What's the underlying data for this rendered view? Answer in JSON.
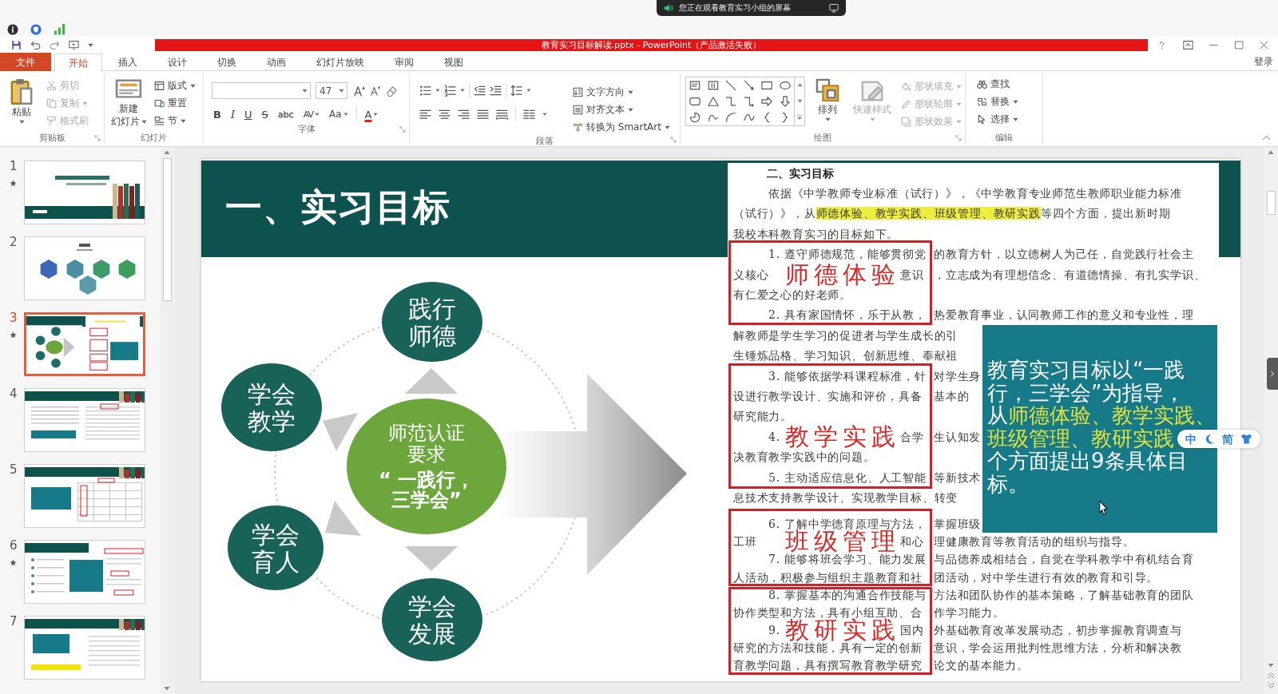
{
  "share_banner": {
    "text": "您正在观看教育实习小组的屏幕"
  },
  "title_bar": {
    "title": "教育实习目标解读.pptx - PowerPoint（产品激活失败）"
  },
  "ribbon": {
    "tabs": [
      {
        "label": "文件",
        "kind": "backstage",
        "selected": false
      },
      {
        "label": "开始",
        "kind": "tab",
        "selected": true
      },
      {
        "label": "插入",
        "kind": "tab",
        "selected": false
      },
      {
        "label": "设计",
        "kind": "tab",
        "selected": false
      },
      {
        "label": "切换",
        "kind": "tab",
        "selected": false
      },
      {
        "label": "动画",
        "kind": "tab",
        "selected": false
      },
      {
        "label": "幻灯片放映",
        "kind": "tab",
        "selected": false
      },
      {
        "label": "审阅",
        "kind": "tab",
        "selected": false
      },
      {
        "label": "视图",
        "kind": "tab",
        "selected": false
      }
    ],
    "account": "登录",
    "groups": [
      {
        "kind": "clipboard",
        "label": "剪贴板",
        "paste": "粘贴",
        "items": [
          {
            "label": "剪切",
            "kind": "cut",
            "disabled": true
          },
          {
            "label": "复制",
            "kind": "copy",
            "disabled": true
          },
          {
            "label": "格式刷",
            "kind": "painter",
            "disabled": true
          }
        ]
      },
      {
        "kind": "slides",
        "label": "幻灯片",
        "new_slide": [
          "新建",
          "幻灯片"
        ],
        "items": [
          {
            "label": "版式",
            "kind": "layout"
          },
          {
            "label": "重置",
            "kind": "reset"
          },
          {
            "label": "节",
            "kind": "section"
          }
        ]
      },
      {
        "kind": "font",
        "label": "字体",
        "font_size": "47",
        "buttons": [
          {
            "label": "B",
            "kind": "bold"
          },
          {
            "label": "I",
            "kind": "italic"
          },
          {
            "label": "U",
            "kind": "underline"
          },
          {
            "label": "S",
            "kind": "strike"
          },
          {
            "label": "abc",
            "kind": "shadow"
          },
          {
            "label": "AV",
            "kind": "spacing"
          },
          {
            "label": "Aa",
            "kind": "case"
          },
          {
            "label": "A",
            "kind": "color"
          }
        ]
      },
      {
        "kind": "paragraph",
        "label": "段落",
        "items": [
          {
            "label": "文字方向",
            "kind": "direction"
          },
          {
            "label": "对齐文本",
            "kind": "align"
          },
          {
            "label": "转换为 SmartArt",
            "kind": "smartart"
          }
        ]
      },
      {
        "kind": "drawing",
        "label": "绘图",
        "arrange": "排列",
        "quick_styles": {
          "label": "快速样式",
          "disabled": true
        },
        "items": [
          {
            "label": "形状填充",
            "kind": "fill",
            "disabled": true
          },
          {
            "label": "形状轮廓",
            "kind": "outline",
            "disabled": true
          },
          {
            "label": "形状效果",
            "kind": "effects",
            "disabled": true
          }
        ]
      },
      {
        "kind": "editing",
        "label": "编辑",
        "items": [
          {
            "label": "查找",
            "kind": "find"
          },
          {
            "label": "替换",
            "kind": "replace"
          },
          {
            "label": "选择",
            "kind": "select"
          }
        ]
      }
    ]
  },
  "slides": [
    {
      "number": "1",
      "kind": "cover",
      "selected": false,
      "animated": true
    },
    {
      "number": "2",
      "kind": "contents",
      "selected": false,
      "animated": false
    },
    {
      "number": "3",
      "kind": "diagram",
      "selected": true,
      "animated": true
    },
    {
      "number": "4",
      "kind": "notes",
      "selected": false,
      "animated": false
    },
    {
      "number": "5",
      "kind": "table",
      "selected": false,
      "animated": false
    },
    {
      "number": "6",
      "kind": "callouts",
      "selected": false,
      "animated": true
    },
    {
      "number": "7",
      "kind": "highlight",
      "selected": false,
      "animated": false
    }
  ],
  "slide": {
    "title": "一、实习目标",
    "diagram": {
      "center": [
        "师范认证",
        "要求",
        "“ 一践行，",
        "三学会”"
      ],
      "nodes": [
        {
          "lines": [
            "践行",
            "师德"
          ]
        },
        {
          "lines": [
            "学会",
            "教学"
          ]
        },
        {
          "lines": [
            "学会",
            "育人"
          ]
        },
        {
          "lines": [
            "学会",
            "发展"
          ]
        }
      ]
    },
    "document": {
      "heading": "二、实习目标",
      "lines": [
        {
          "kind": "first",
          "text": "依据《中学教师专业标准（试行）》，《中学教育专业师范生教师职业能力标准"
        },
        {
          "kind": "marked",
          "segments": [
            {
              "text": "（试行）》，从",
              "highlight": false
            },
            {
              "text": "师德体验、教学实践、班级管理、教研实践",
              "highlight": true
            },
            {
              "text": "等四个方面，提出新时期",
              "highlight": false
            }
          ]
        },
        {
          "kind": "wrap",
          "text": "我校本科教育实习的目标如下。"
        },
        {
          "kind": "first",
          "parts": [
            "1. 遵守师德规范，能够贯彻党",
            "的教育方针，以立德树人为己任，自觉践行社会主"
          ]
        },
        {
          "kind": "split",
          "before": "义核心",
          "middle": "意识",
          "after": "，立志成为有理想信念、有道德情操、有扎实学识、"
        },
        {
          "kind": "wrap",
          "text": "有仁爱之心的好老师。"
        },
        {
          "kind": "first",
          "parts": [
            "2. 具有家国情怀，乐于从教，",
            "热爱教育事业，认同教师工作的意义和专业性，理"
          ]
        },
        {
          "kind": "wrap",
          "text": "解教师是学生学习的促进者与学生成长的引"
        },
        {
          "kind": "wrap",
          "text": "生锤炼品格、学习知识、创新思维、奉献祖"
        },
        {
          "kind": "first",
          "parts": [
            "3. 能够依据学科课程标准，针",
            "对学生身"
          ]
        },
        {
          "kind": "wrap",
          "parts": [
            "设进行教学设计、实施和评价，具备",
            "基本的"
          ]
        },
        {
          "kind": "wrap",
          "text": "研究能力。"
        },
        {
          "kind": "split_first",
          "before": "4.",
          "middle": "合学",
          "after": "生认知发"
        },
        {
          "kind": "wrap",
          "text": "决教育教学实践中的问题。"
        },
        {
          "kind": "first",
          "parts": [
            "5. 主动适应信息化、人工智能",
            "等新技术"
          ]
        },
        {
          "kind": "wrap",
          "text": "息技术支持教学设计、实现教学目标、转变"
        },
        {
          "kind": "first",
          "parts": [
            "6. 了解中学德育原理与方法，",
            "掌握班级"
          ]
        },
        {
          "kind": "split",
          "before": "工班",
          "middle": "和心",
          "after": "理健康教育等教育活动的组织与指导。"
        },
        {
          "kind": "first",
          "parts": [
            "7. 能够将班会学习、能力发展",
            "与品德养成相结合，自觉在学科教学中有机结合育"
          ]
        },
        {
          "kind": "wrap",
          "parts": [
            "人活动，积极参与组织主题教育和社",
            "团活动，对中学生进行有效的教育和引导。"
          ]
        },
        {
          "kind": "first",
          "parts": [
            "8. 掌握基本的沟通合作技能与",
            "方法和团队协作的基本策略，了解基础教育的团队"
          ]
        },
        {
          "kind": "wrap",
          "parts": [
            "协作类型和方法，具有小组互助、合",
            "作学习能力。"
          ]
        },
        {
          "kind": "split_first",
          "before": "9.",
          "middle": "国内",
          "after": "外基础教育改革发展动态，初步掌握教育调查与"
        },
        {
          "kind": "wrap",
          "parts": [
            "研究的方法和技能，具有一定的创新",
            "意识，学会运用批判性思维方法，分析和解决教"
          ]
        },
        {
          "kind": "wrap",
          "parts": [
            "育教学问题，具有撰写教育教学研究",
            "论文的基本能力。"
          ]
        }
      ],
      "frames": [
        {
          "label": "师德体验"
        },
        {
          "label": "教学实践"
        },
        {
          "label": "班级管理"
        },
        {
          "label": "教研实践"
        }
      ]
    },
    "summary": {
      "lines": [
        {
          "segments": [
            {
              "text": "教育实习目标以“一践",
              "highlight": false
            }
          ]
        },
        {
          "segments": [
            {
              "text": "行，三学会”为指导，",
              "highlight": false
            }
          ]
        },
        {
          "segments": [
            {
              "text": "从",
              "highlight": false
            },
            {
              "text": "师德体验、教学实践、",
              "highlight": true
            }
          ]
        },
        {
          "segments": [
            {
              "text": "班级管理、教研实践",
              "highlight": true
            }
          ]
        },
        {
          "segments": [
            {
              "text": "个方面提出9条具体目",
              "highlight": false
            }
          ]
        },
        {
          "segments": [
            {
              "text": "标。",
              "highlight": false
            }
          ]
        }
      ]
    }
  },
  "ime_toolbar": {
    "mode": "中",
    "script": "简"
  }
}
